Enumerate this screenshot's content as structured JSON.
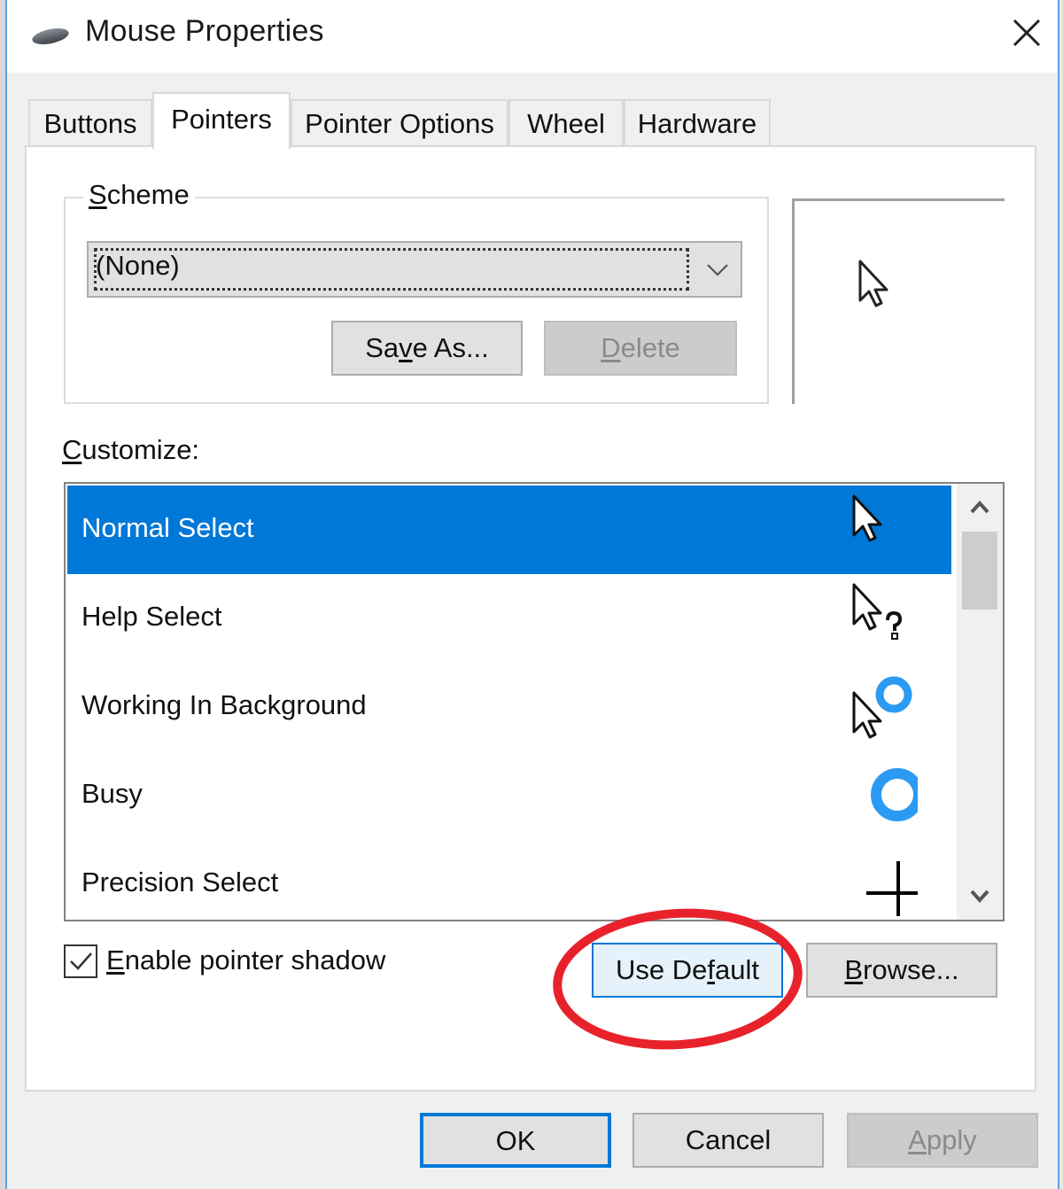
{
  "window": {
    "title": "Mouse Properties",
    "icon": "mouse-icon",
    "close_icon": "close-icon"
  },
  "tabs": [
    {
      "label": "Buttons",
      "active": false
    },
    {
      "label": "Pointers",
      "active": true
    },
    {
      "label": "Pointer Options",
      "active": false
    },
    {
      "label": "Wheel",
      "active": false
    },
    {
      "label": "Hardware",
      "active": false
    }
  ],
  "scheme": {
    "group_label_accel": "S",
    "group_label_rest": "cheme",
    "selected_value": "(None)",
    "save_as": {
      "pre": "Sa",
      "accel": "v",
      "post": "e As..."
    },
    "delete": {
      "pre": "",
      "accel": "D",
      "post": "elete",
      "disabled": true
    }
  },
  "preview": {
    "cursor": "normal-select-arrow-icon"
  },
  "customize": {
    "label_accel": "C",
    "label_rest": "ustomize:",
    "items": [
      {
        "label": "Normal Select",
        "icon": "arrow-cursor-icon",
        "selected": true
      },
      {
        "label": "Help Select",
        "icon": "help-cursor-icon",
        "selected": false
      },
      {
        "label": "Working In Background",
        "icon": "working-cursor-icon",
        "selected": false
      },
      {
        "label": "Busy",
        "icon": "busy-cursor-icon",
        "selected": false
      },
      {
        "label": "Precision Select",
        "icon": "crosshair-cursor-icon",
        "selected": false
      }
    ]
  },
  "pointer_shadow": {
    "label_accel": "E",
    "label_rest": "nable pointer shadow",
    "checked": true
  },
  "buttons": {
    "use_default": {
      "pre": "Use De",
      "accel": "f",
      "post": "ault"
    },
    "browse": {
      "pre": "",
      "accel": "B",
      "post": "rowse..."
    },
    "ok": "OK",
    "cancel": "Cancel",
    "apply": {
      "pre": "",
      "accel": "A",
      "post": "pply",
      "disabled": true
    }
  },
  "annotation": {
    "shape": "ellipse",
    "color": "#e8222b",
    "target": "use-default-button"
  },
  "colors": {
    "selection": "#0078d7",
    "busy_ring": "#2b9af3",
    "annotation": "#e8222b"
  }
}
